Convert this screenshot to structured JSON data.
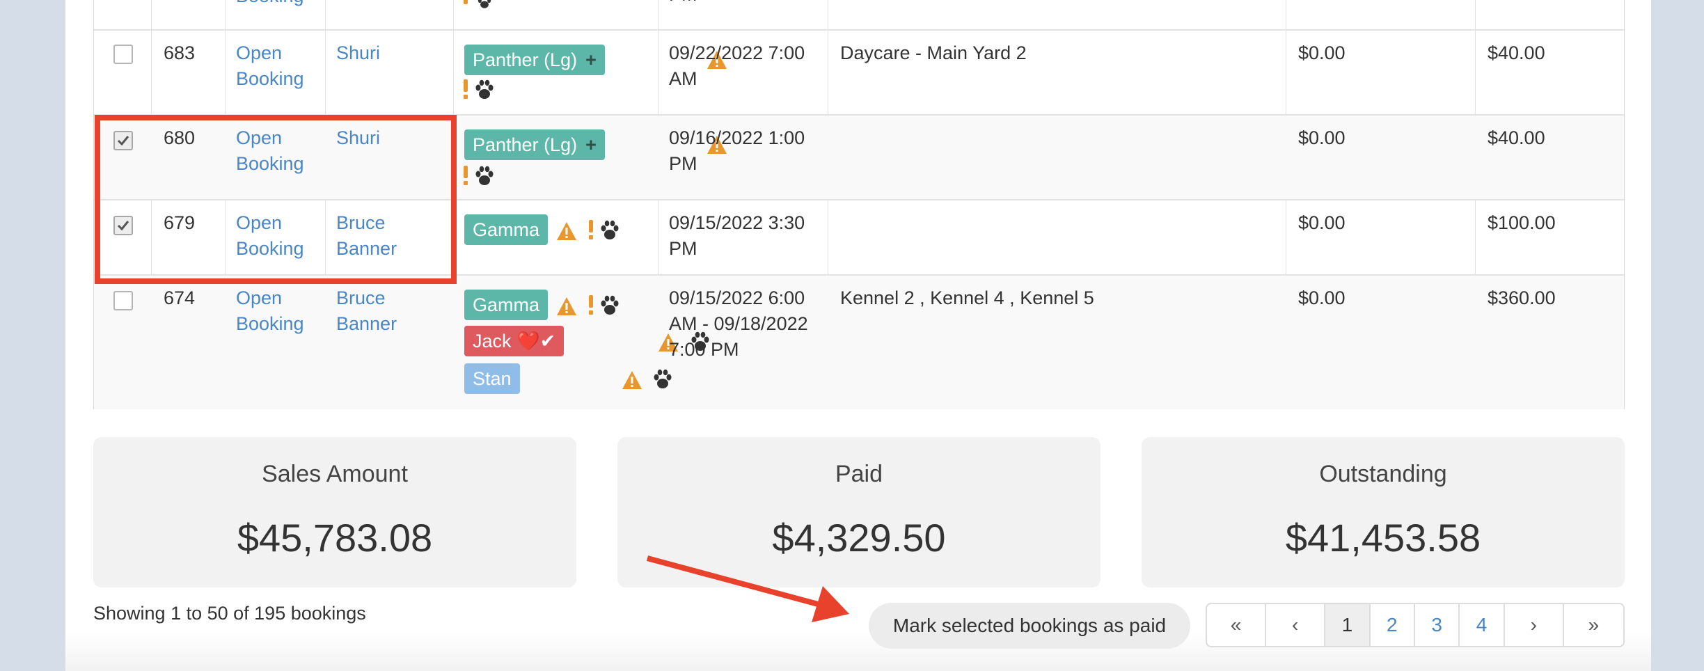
{
  "rows": [
    {
      "cut": true,
      "booking": "Booking"
    },
    {
      "id": "683",
      "action": [
        "Open",
        "Booking"
      ],
      "customer": [
        "Shuri"
      ],
      "pets": [
        {
          "name": "Panther (Lg)",
          "color": "#5db7a8"
        }
      ],
      "date": [
        "09/22/2022 7:00",
        "AM"
      ],
      "kennel": "Daycare - Main Yard 2",
      "paid": "$0.00",
      "total": "$40.00",
      "checked": false
    },
    {
      "id": "680",
      "action": [
        "Open",
        "Booking"
      ],
      "customer": [
        "Shuri"
      ],
      "pets": [
        {
          "name": "Panther (Lg)",
          "color": "#5db7a8"
        }
      ],
      "date": [
        "09/16/2022 1:00",
        "PM"
      ],
      "kennel": "",
      "paid": "$0.00",
      "total": "$40.00",
      "checked": true
    },
    {
      "id": "679",
      "action": [
        "Open",
        "Booking"
      ],
      "customer": [
        "Bruce",
        "Banner"
      ],
      "pets": [
        {
          "name": "Gamma",
          "color": "#5db7a8"
        }
      ],
      "date": [
        "09/15/2022 3:30",
        "PM"
      ],
      "kennel": "",
      "paid": "$0.00",
      "total": "$100.00",
      "checked": true
    },
    {
      "id": "674",
      "action": [
        "Open",
        "Booking"
      ],
      "customer": [
        "Bruce",
        "Banner"
      ],
      "pets": [
        {
          "name": "Gamma",
          "color": "#5db7a8"
        },
        {
          "name": "Jack ❤️✔",
          "color": "#de5a5f"
        },
        {
          "name": "Stan",
          "color": "#8fbde8"
        }
      ],
      "date": [
        "09/15/2022 6:00",
        "AM - 09/18/2022",
        "7:00 PM"
      ],
      "kennel": "Kennel 2 , Kennel 4 , Kennel 5",
      "paid": "$0.00",
      "total": "$360.00",
      "checked": false
    }
  ],
  "summary": {
    "sales": {
      "label": "Sales Amount",
      "value": "$45,783.08"
    },
    "paid": {
      "label": "Paid",
      "value": "$4,329.50"
    },
    "outstanding": {
      "label": "Outstanding",
      "value": "$41,453.58"
    }
  },
  "footer": {
    "showing": "Showing 1 to 50 of 195 bookings",
    "mark_paid_button": "Mark selected bookings as paid"
  },
  "pagination": {
    "first": "«",
    "prev": "‹",
    "pages": [
      "1",
      "2",
      "3",
      "4"
    ],
    "active_page": "1",
    "next": "›",
    "last": "»"
  },
  "icons": {
    "warning": "warning-triangle-icon",
    "alert": "exclamation-icon",
    "paw": "paw-icon",
    "add": "plus-icon",
    "check": "checkmark-icon"
  },
  "colors": {
    "link": "#4a86c5",
    "warning": "#e8962e",
    "highlight": "#e8412c",
    "arrow": "#e8412c"
  }
}
